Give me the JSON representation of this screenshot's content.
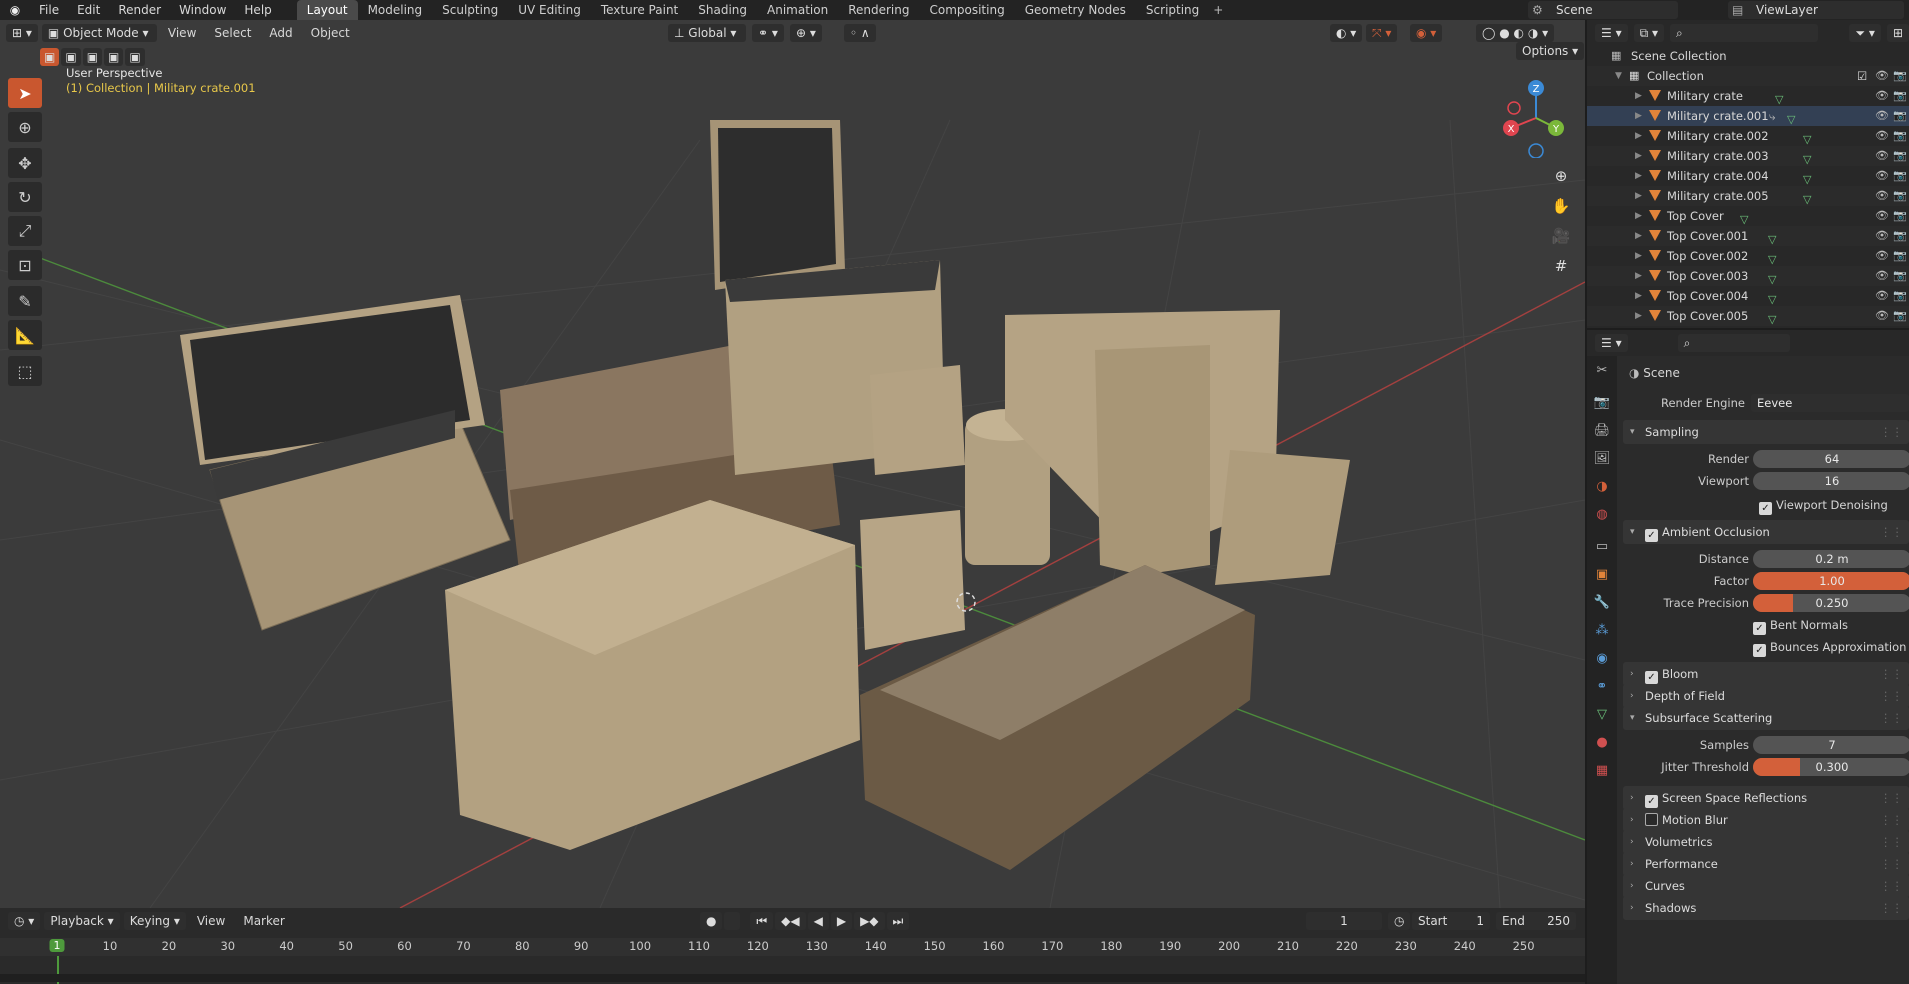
{
  "topbar": {
    "menus": [
      "File",
      "Edit",
      "Render",
      "Window",
      "Help"
    ],
    "workspaces": [
      "Layout",
      "Modeling",
      "Sculpting",
      "UV Editing",
      "Texture Paint",
      "Shading",
      "Animation",
      "Rendering",
      "Compositing",
      "Geometry Nodes",
      "Scripting"
    ],
    "active_workspace": "Layout",
    "scene": "Scene",
    "view_layer": "ViewLayer"
  },
  "viewport": {
    "mode": "Object Mode",
    "menus": [
      "View",
      "Select",
      "Add",
      "Object"
    ],
    "orientation": "Global",
    "options_label": "Options",
    "perspective_label": "User Perspective",
    "collection_label": "(1) Collection | Military crate.001",
    "gizmo": {
      "x": "X",
      "y": "Y",
      "z": "Z"
    }
  },
  "outliner": {
    "root": "Scene Collection",
    "collection": "Collection",
    "objects": [
      "Military crate",
      "Military crate.001",
      "Military crate.002",
      "Military crate.003",
      "Military crate.004",
      "Military crate.005",
      "Top Cover",
      "Top Cover.001",
      "Top Cover.002",
      "Top Cover.003",
      "Top Cover.004",
      "Top Cover.005"
    ]
  },
  "properties": {
    "context": "Scene",
    "render_engine_label": "Render Engine",
    "render_engine": "Eevee",
    "sampling": {
      "title": "Sampling",
      "render_label": "Render",
      "render": "64",
      "viewport_label": "Viewport",
      "viewport": "16",
      "denoise_label": "Viewport Denoising"
    },
    "ao": {
      "title": "Ambient Occlusion",
      "distance_label": "Distance",
      "distance": "0.2 m",
      "factor_label": "Factor",
      "factor": "1.00",
      "factor_fill": 1.0,
      "trace_label": "Trace Precision",
      "trace": "0.250",
      "trace_fill": 0.25,
      "bent_label": "Bent Normals",
      "bounces_label": "Bounces Approximation"
    },
    "bloom": "Bloom",
    "dof": "Depth of Field",
    "sss": {
      "title": "Subsurface Scattering",
      "samples_label": "Samples",
      "samples": "7",
      "jitter_label": "Jitter Threshold",
      "jitter": "0.300",
      "jitter_fill": 0.3
    },
    "ssr": "Screen Space Reflections",
    "motion_blur": "Motion Blur",
    "volumetrics": "Volumetrics",
    "performance": "Performance",
    "curves": "Curves",
    "shadows": "Shadows"
  },
  "timeline": {
    "playback": "Playback",
    "keying": "Keying",
    "view": "View",
    "marker": "Marker",
    "current_frame": "1",
    "start_label": "Start",
    "start": "1",
    "end_label": "End",
    "end": "250",
    "ruler": [
      "10",
      "20",
      "30",
      "40",
      "50",
      "60",
      "70",
      "80",
      "90",
      "100",
      "110",
      "120",
      "130",
      "140",
      "150",
      "160",
      "170",
      "180",
      "190",
      "200",
      "210",
      "220",
      "230",
      "240",
      "250"
    ]
  },
  "colors": {
    "accent": "#d3603a",
    "active_frame": "#4e9a3c",
    "x_axis": "#e0454f",
    "y_axis": "#7bb83a",
    "z_axis": "#3b8ad6"
  }
}
